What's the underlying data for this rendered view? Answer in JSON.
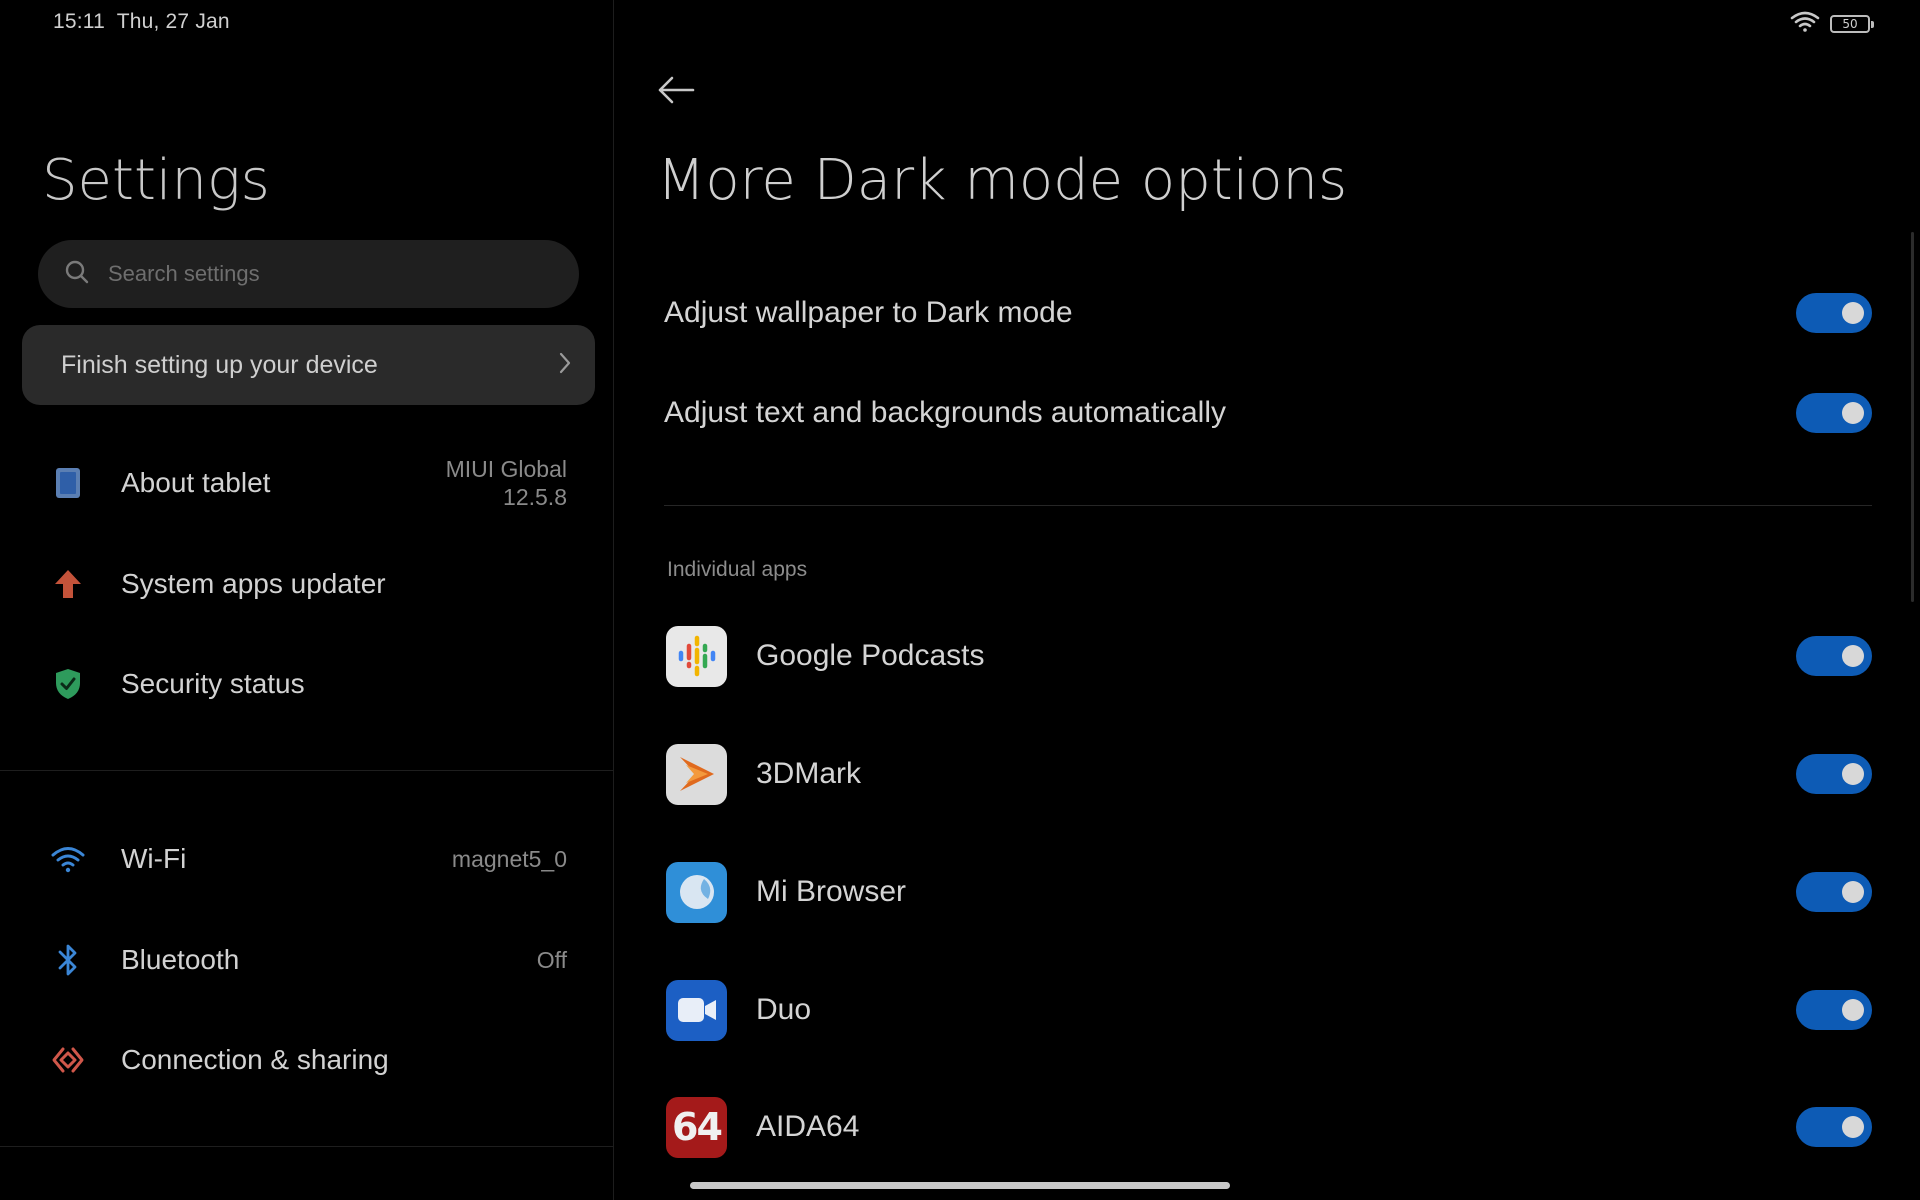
{
  "status_bar": {
    "time": "15:11",
    "date": "Thu, 27 Jan",
    "battery": "50"
  },
  "left": {
    "title": "Settings",
    "search_placeholder": "Search settings",
    "finish_card": "Finish setting up your device",
    "items": [
      {
        "label": "About tablet",
        "value_line1": "MIUI Global",
        "value_line2": "12.5.8",
        "icon": "tablet-icon"
      },
      {
        "label": "System apps updater",
        "icon": "arrow-up-icon"
      },
      {
        "label": "Security status",
        "icon": "shield-check-icon"
      },
      {
        "label": "Wi-Fi",
        "value": "magnet5_0",
        "icon": "wifi-icon"
      },
      {
        "label": "Bluetooth",
        "value": "Off",
        "icon": "bluetooth-icon"
      },
      {
        "label": "Connection & sharing",
        "icon": "connection-sharing-icon"
      }
    ]
  },
  "right": {
    "title": "More Dark mode options",
    "options": [
      {
        "label": "Adjust wallpaper to Dark mode",
        "enabled": true
      },
      {
        "label": "Adjust text and backgrounds automatically",
        "enabled": true
      }
    ],
    "section_label": "Individual apps",
    "apps": [
      {
        "name": "Google Podcasts",
        "enabled": true,
        "icon": "google-podcasts-icon"
      },
      {
        "name": "3DMark",
        "enabled": true,
        "icon": "3dmark-icon"
      },
      {
        "name": "Mi Browser",
        "enabled": true,
        "icon": "mi-browser-icon"
      },
      {
        "name": "Duo",
        "enabled": true,
        "icon": "duo-icon"
      },
      {
        "name": "AIDA64",
        "enabled": true,
        "icon": "aida64-icon",
        "icon_text": "64"
      }
    ]
  },
  "colors": {
    "accent": "#0d5bb5",
    "background": "#000000",
    "card": "#2a2a2a"
  }
}
